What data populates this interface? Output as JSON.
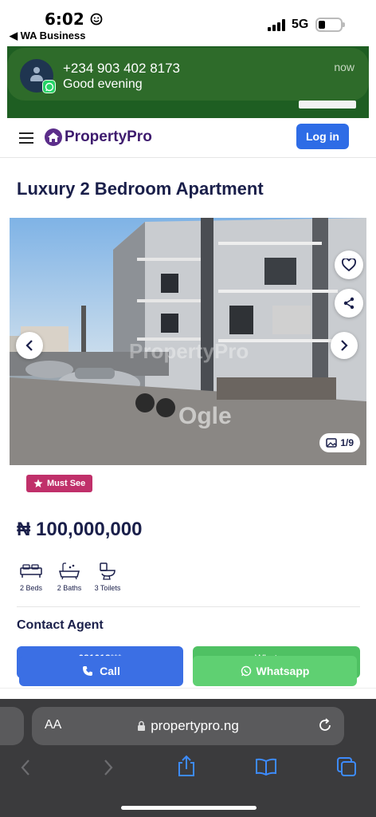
{
  "status_bar": {
    "time": "6:02",
    "back_app": "◀ WA Business",
    "network": "5G"
  },
  "notification": {
    "title": "+234 903 402 8173",
    "message": "Good evening",
    "time": "now",
    "app_icon": "whatsapp-icon"
  },
  "header": {
    "logo": "PropertyPro",
    "login_label": "Log in"
  },
  "listing": {
    "title": "Luxury 2 Bedroom Apartment",
    "gallery_counter": "1/9",
    "watermark_top": "PropertyPro",
    "watermark_bottom": "Ogle",
    "badge": "Must See",
    "price": "₦ 100,000,000",
    "features": [
      {
        "icon": "bed-icon",
        "label": "2 Beds"
      },
      {
        "icon": "bath-icon",
        "label": "2 Baths"
      },
      {
        "icon": "toilet-icon",
        "label": "3 Toilets"
      }
    ]
  },
  "contact": {
    "title": "Contact Agent",
    "phone_masked": "081018***",
    "whatsapp_behind": "Whatsapp",
    "call_label": "Call",
    "whatsapp_label": "Whatsapp"
  },
  "browser": {
    "aa_label": "AA",
    "url": "propertypro.ng"
  },
  "colors": {
    "brand_navy": "#1a1f4a",
    "login_blue": "#2e6ce6",
    "call_blue": "#3b6fe4",
    "whatsapp_green": "#5fd072",
    "badge_magenta": "#c0306a",
    "notification_green": "#2e6b2a"
  }
}
